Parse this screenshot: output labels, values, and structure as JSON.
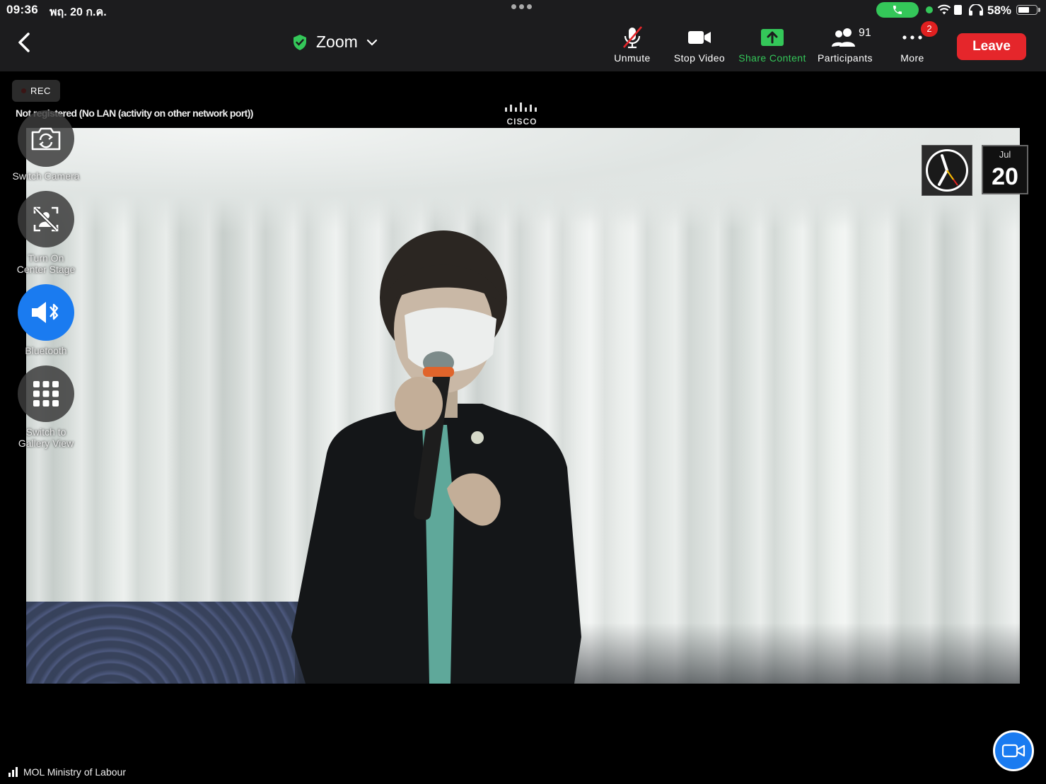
{
  "status_bar": {
    "time": "09:36",
    "date": "พฤ. 20 ก.ค.",
    "battery": "58%"
  },
  "toolbar": {
    "title": "Zoom",
    "unmute_label": "Unmute",
    "stop_video_label": "Stop Video",
    "share_label": "Share Content",
    "participants_label": "Participants",
    "participants_count": "91",
    "more_label": "More",
    "more_badge": "2",
    "leave_label": "Leave"
  },
  "overlay": {
    "rec_label": "REC",
    "network_message": "Not registered (No LAN (activity on other network port))",
    "cisco_label": "CISCO",
    "calendar_month": "Jul",
    "calendar_day": "20"
  },
  "side_controls": {
    "switch_camera": "Switch Camera",
    "center_stage_line1": "Turn On",
    "center_stage_line2": "Center Stage",
    "bluetooth": "Bluetooth",
    "gallery_line1": "Switch to",
    "gallery_line2": "Gallery View"
  },
  "bottom": {
    "participant_name": "MOL Ministry of Labour"
  },
  "colors": {
    "accent_blue": "#1a7bf0",
    "share_green": "#34c759",
    "leave_red": "#e5262b",
    "toolbar_bg": "#1c1c1e"
  }
}
